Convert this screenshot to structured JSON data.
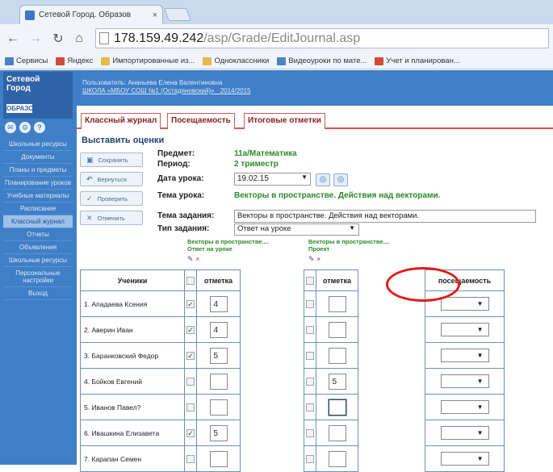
{
  "browser": {
    "tab_title": "Сетевой Город. Образов",
    "tab_close": "×",
    "url_host": "178.159.49.242",
    "url_path": "/asp/Grade/EditJournal.asp",
    "bookmarks": [
      "Сервисы",
      "Яндекс",
      "Импортированные из...",
      "Одноклассники",
      "Видеоуроки по мате...",
      "Учет и планирован..."
    ]
  },
  "sidebar": {
    "logo_line1": "Сетевой",
    "logo_line2": "Город",
    "logo_sub": "ОБРАЗОВАНИЕ",
    "menu": [
      "Школьные ресурсы",
      "Документы",
      "Планы и предметы",
      "Планирование уроков",
      "Учебные материалы",
      "Расписание",
      "Классный журнал",
      "Отчеты",
      "Объявления",
      "Школьные ресурсы",
      "Персональные настройки",
      "Выход"
    ]
  },
  "header": {
    "user_line": "Пользователь: Ананьева Елена Валентиновна",
    "school_line": "ШКОЛА «МБОУ СОШ №1 (Остадяновский)» · 2014/2015"
  },
  "tabs": [
    "Классный журнал",
    "Посещаемость",
    "Итоговые отметки"
  ],
  "form": {
    "title": "Выставить оценки",
    "buttons": [
      "Сохранить",
      "Вернуться",
      "Проверить",
      "Отменить"
    ],
    "subject_label": "Предмет:",
    "subject_value": "11а/Математика",
    "period_label": "Период:",
    "period_value": "2 триместр",
    "date_label": "Дата урока:",
    "date_value": "19.02.15",
    "topic_label": "Тема урока:",
    "topic_value": "Векторы в пространстве. Действия над векторами.",
    "task_label": "Тема задания:",
    "task_value": "Векторы в пространстве. Действия над векторами.",
    "type_label": "Тип задания:",
    "type_value": "Ответ на уроке"
  },
  "columns": {
    "col1_head": "Векторы в пространстве....",
    "col1_sub": "Ответ на уроке",
    "col2_head": "Векторы в пространстве....",
    "col2_sub": "Проект"
  },
  "table": {
    "headers": [
      "Ученики",
      "отметка",
      "отметка",
      "посещаемость"
    ],
    "rows": [
      {
        "name": "1. Ападаева Ксения",
        "c1": true,
        "m1": "4",
        "c2": false,
        "m2": ""
      },
      {
        "name": "2. Аверин Иван",
        "c1": true,
        "m1": "4",
        "c2": false,
        "m2": ""
      },
      {
        "name": "3. Баранковский Федор",
        "c1": true,
        "m1": "5",
        "c2": false,
        "m2": ""
      },
      {
        "name": "4. Бойков Евгений",
        "c1": false,
        "m1": "",
        "c2": false,
        "m2": "5"
      },
      {
        "name": "5. Иванов Павел?",
        "c1": false,
        "m1": "",
        "c2": false,
        "m2": ""
      },
      {
        "name": "6. Ивашкина Елизавета",
        "c1": true,
        "m1": "5",
        "c2": false,
        "m2": ""
      },
      {
        "name": "7. Карапан Семен",
        "c1": false,
        "m1": "",
        "c2": false,
        "m2": ""
      }
    ]
  },
  "colors": {
    "accent": "#3f7fc7",
    "tab_border": "#c85a5a",
    "value_green": "#2a8a2a",
    "annotation": "#e21b1b"
  }
}
